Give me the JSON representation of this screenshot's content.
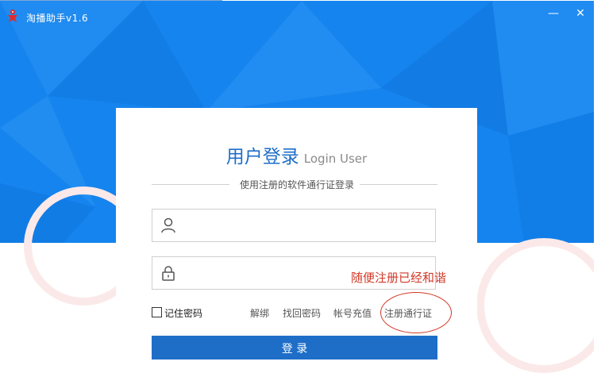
{
  "window": {
    "title": "淘播助手v1.6",
    "minimize_glyph": "—",
    "close_glyph": "✕"
  },
  "login": {
    "title": "用户登录",
    "title_en": "Login User",
    "subtitle": "使用注册的软件通行证登录",
    "username": {
      "value": "",
      "placeholder": ""
    },
    "password": {
      "value": "",
      "placeholder": ""
    },
    "annotation": "随便注册已经和谐",
    "remember_label": "记住密码",
    "links": [
      "解绑",
      "找回密码",
      "帐号充值",
      "注册通行证"
    ],
    "login_button": "登 录"
  },
  "colors": {
    "hero_bg": "#1684ee",
    "brand_blue": "#1e6ec8",
    "annotation_red": "#d23a2a"
  },
  "icons": {
    "logo": "red-figure-logo-icon",
    "user": "user-icon",
    "lock": "lock-icon"
  }
}
